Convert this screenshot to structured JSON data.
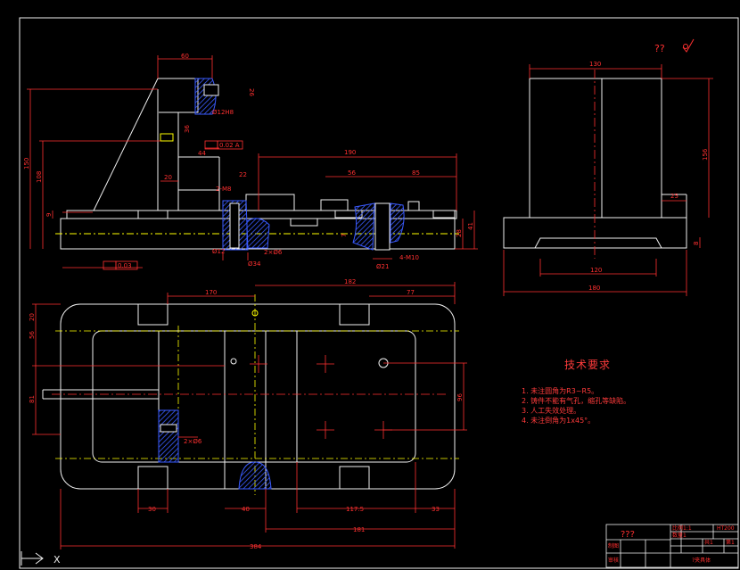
{
  "top_note": "?? ",
  "tech_requirements": {
    "title": "技术要求",
    "items": [
      "1. 未注圆角为R3~R5。",
      "2. 铸件不能有气孔，缩孔等缺陷。",
      "3. 人工失效处理。",
      "4. 未注倒角为1x45°。"
    ]
  },
  "front_view_dims": {
    "d60": "60",
    "d26": "26",
    "d312": "Ø12H8",
    "d36": "36",
    "d002": "0.02 A",
    "d44": "44",
    "d20": "20",
    "d22": "22",
    "d2m8": "2-M8",
    "d190": "190",
    "d56": "56",
    "d85": "85",
    "d150": "150",
    "d108": "108",
    "d9": "9",
    "d28": "28",
    "d41": "41",
    "d7": "7",
    "d12": "Ø12",
    "d34": "Ø34",
    "d2x6": "2×Ø6",
    "d021": "Ø21",
    "m10": "4-M10",
    "flat": "0.03"
  },
  "side_view_dims": {
    "d130": "130",
    "d156": "156",
    "d25": "25",
    "d8": "8",
    "d120": "120",
    "d180": "180"
  },
  "plan_view_dims": {
    "d170": "170",
    "d182": "182",
    "d77": "77",
    "d20": "20",
    "d56": "56",
    "d81": "81",
    "d96": "96",
    "d30": "30",
    "d40": "40",
    "d117": "117.5",
    "d33": "33",
    "d181": "181",
    "d384": "384",
    "d2x6": "2×Ø6"
  },
  "title_block": {
    "name": "???",
    "scale_label": "比例",
    "scale": "1:1",
    "qty_label": "数量",
    "qty": "1",
    "sheet_label": "共1",
    "sheet_no": "第1",
    "material": "HT200",
    "drawer": "制图",
    "checker": "审核",
    "drawing_no": "?夹具体"
  },
  "axis_label": "X"
}
